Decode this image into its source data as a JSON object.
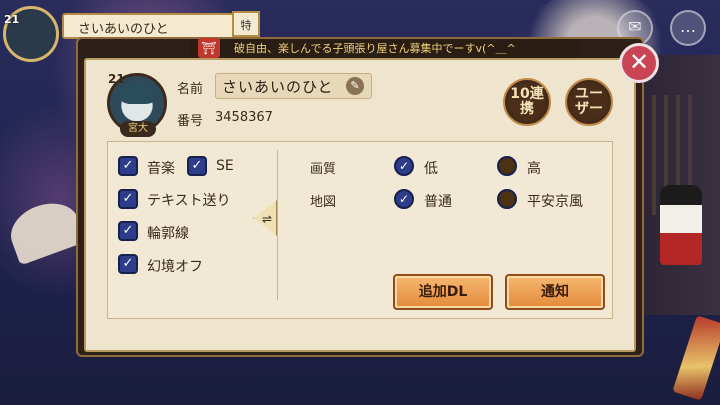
{
  "hud": {
    "level": "21",
    "player_name": "さいあいのひと",
    "tag": "特"
  },
  "ticker": {
    "text": "破自由、楽しんでる子頭張り屋さん募集中でーすv(^＿^"
  },
  "profile": {
    "level": "21",
    "name_label": "名前",
    "name_value": "さいあいのひと",
    "id_label": "番号",
    "id_value": "3458367",
    "role_badge": "宮大",
    "link_button": "10連\n携",
    "user_button": "ユー\nザー"
  },
  "settings": {
    "music": {
      "label": "音楽",
      "checked": true
    },
    "se": {
      "label": "SE",
      "checked": true
    },
    "text_advance": {
      "label": "テキスト送り",
      "checked": true
    },
    "outline": {
      "label": "輪郭線",
      "checked": true
    },
    "illusion_off": {
      "label": "幻境オフ",
      "checked": true
    },
    "quality": {
      "label": "画質",
      "options": [
        "低",
        "高"
      ],
      "selected": "低"
    },
    "map": {
      "label": "地図",
      "options": [
        "普通",
        "平安京風"
      ],
      "selected": "普通"
    },
    "add_dl_button": "追加DL",
    "notify_button": "通知"
  },
  "icons": {
    "close": "close-icon",
    "edit": "pencil-icon",
    "swap": "swap-icon",
    "mail": "mail-icon",
    "chat": "chat-icon"
  }
}
